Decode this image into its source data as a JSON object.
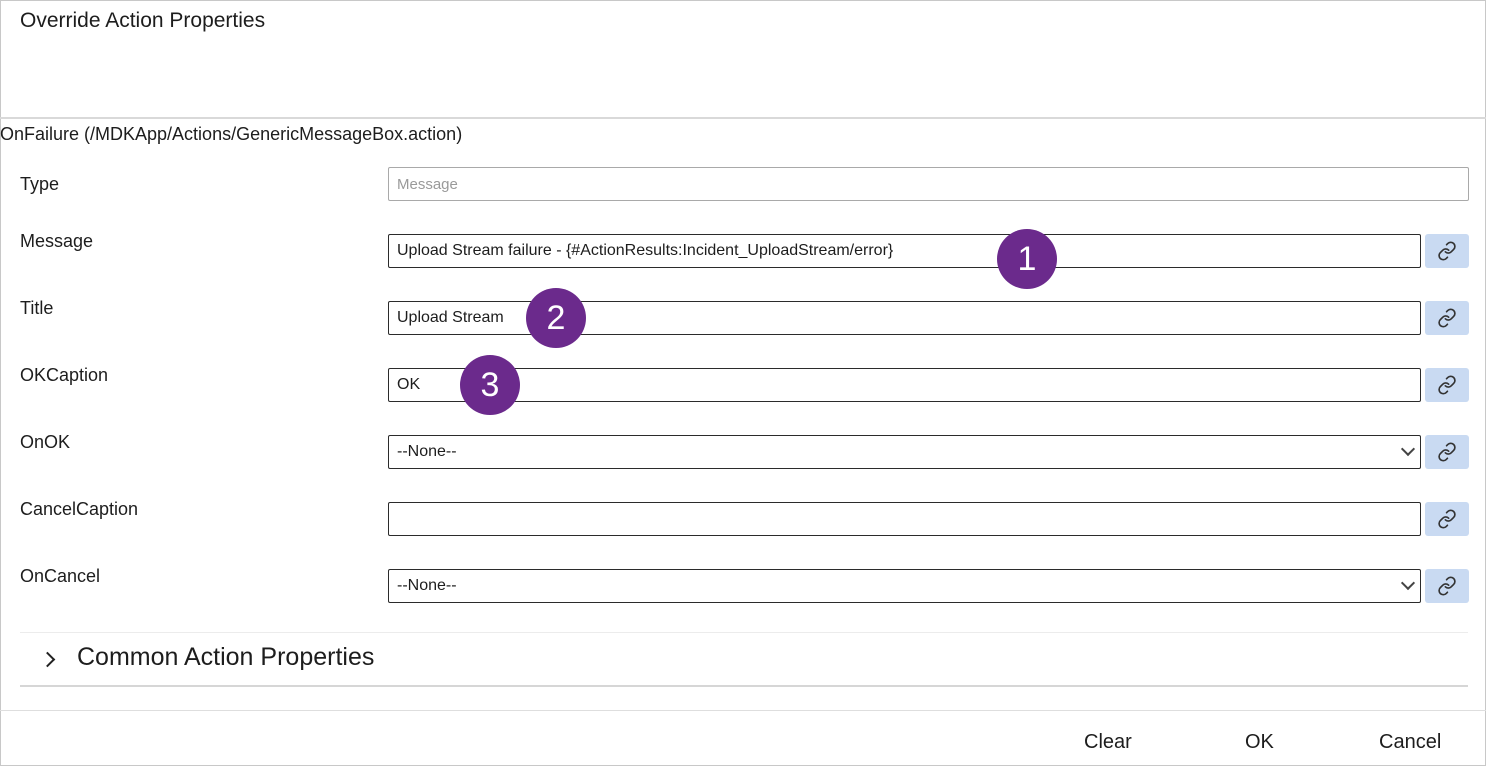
{
  "dialog": {
    "title": "Override Action Properties",
    "section_title": "OnFailure (/MDKApp/Actions/GenericMessageBox.action)"
  },
  "rows": {
    "type": {
      "label": "Type",
      "placeholder": "Message"
    },
    "message": {
      "label": "Message",
      "value": "Upload Stream failure - {#ActionResults:Incident_UploadStream/error}"
    },
    "title": {
      "label": "Title",
      "value": "Upload Stream"
    },
    "okcaption": {
      "label": "OKCaption",
      "value": "OK"
    },
    "onok": {
      "label": "OnOK",
      "value": "--None--"
    },
    "cancelcaption": {
      "label": "CancelCaption",
      "value": ""
    },
    "oncancel": {
      "label": "OnCancel",
      "value": "--None--"
    }
  },
  "badges": [
    "1",
    "2",
    "3"
  ],
  "common_section": {
    "label": "Common Action Properties",
    "icon": "chevron-right-icon"
  },
  "footer": {
    "clear": "Clear",
    "ok": "OK",
    "cancel": "Cancel"
  },
  "colors": {
    "badge": "#6b2a8c",
    "link_button": "#c9daf2"
  },
  "icons": {
    "link": "link-icon",
    "dropdown": "chevron-down-icon"
  }
}
